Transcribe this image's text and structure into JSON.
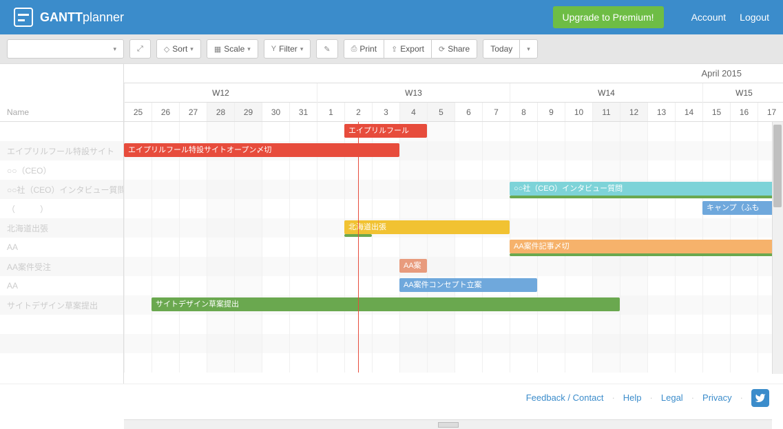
{
  "brand": {
    "bold": "GANTT",
    "light": "planner"
  },
  "header": {
    "upgrade": "Upgrade to Premium!",
    "account": "Account",
    "logout": "Logout"
  },
  "toolbar": {
    "sort": "Sort",
    "scale": "Scale",
    "filter": "Filter",
    "print": "Print",
    "export": "Export",
    "share": "Share",
    "today": "Today"
  },
  "timeline": {
    "month": "April 2015",
    "weeks": [
      "W12",
      "W13",
      "W14",
      "W15"
    ],
    "days": [
      "25",
      "26",
      "27",
      "28",
      "29",
      "30",
      "31",
      "1",
      "2",
      "3",
      "4",
      "5",
      "6",
      "7",
      "8",
      "9",
      "10",
      "11",
      "12",
      "13",
      "14",
      "15",
      "16",
      "17"
    ],
    "week_starts": [
      0,
      7,
      14,
      21
    ],
    "weekend_indices": [
      3,
      4,
      10,
      11,
      17,
      18
    ],
    "today_index": 8,
    "name_header": "Name"
  },
  "rows": [
    {
      "label": "",
      "bar": {
        "text": "エイプリルフール",
        "color": "red",
        "start": 8,
        "span": 3
      }
    },
    {
      "label": "エイプリルフール特設サイト",
      "bar": {
        "text": "エイプリルフール特設サイトオープン〆切",
        "color": "red",
        "start": 0,
        "span": 10
      }
    },
    {
      "label": "○○（CEO）",
      "bar": null
    },
    {
      "label": "○○社（CEO）インタビュー質問",
      "bar": {
        "text": "○○社（CEO）インタビュー質問",
        "color": "cyan",
        "start": 14,
        "span": 12,
        "progress": {
          "start": 14,
          "span": 12
        }
      }
    },
    {
      "label": "（　　　）",
      "bar": {
        "text": "キャンプ（ふも",
        "color": "blue",
        "start": 21,
        "span": 3
      }
    },
    {
      "label": "北海道出張",
      "bar": {
        "text": "北海道出張",
        "color": "yellow",
        "start": 8,
        "span": 6,
        "progress": {
          "start": 8,
          "span": 1
        }
      }
    },
    {
      "label": "AA",
      "bar": {
        "text": "AA案件記事〆切",
        "color": "orange",
        "start": 14,
        "span": 12,
        "progress": {
          "start": 14,
          "span": 12
        }
      }
    },
    {
      "label": "AA案件受注",
      "bar": {
        "text": "AA案",
        "color": "salmon",
        "start": 10,
        "span": 1
      }
    },
    {
      "label": "AA",
      "bar": {
        "text": "AA案件コンセプト立案",
        "color": "blue",
        "start": 10,
        "span": 5
      }
    },
    {
      "label": "サイトデザイン草案提出",
      "bar": {
        "text": "サイトデザイン草案提出",
        "color": "green",
        "start": 1,
        "span": 17
      }
    },
    {
      "label": "",
      "bar": null
    },
    {
      "label": "",
      "bar": null
    },
    {
      "label": "",
      "bar": null
    }
  ],
  "footer": {
    "feedback": "Feedback / Contact",
    "help": "Help",
    "legal": "Legal",
    "privacy": "Privacy"
  }
}
